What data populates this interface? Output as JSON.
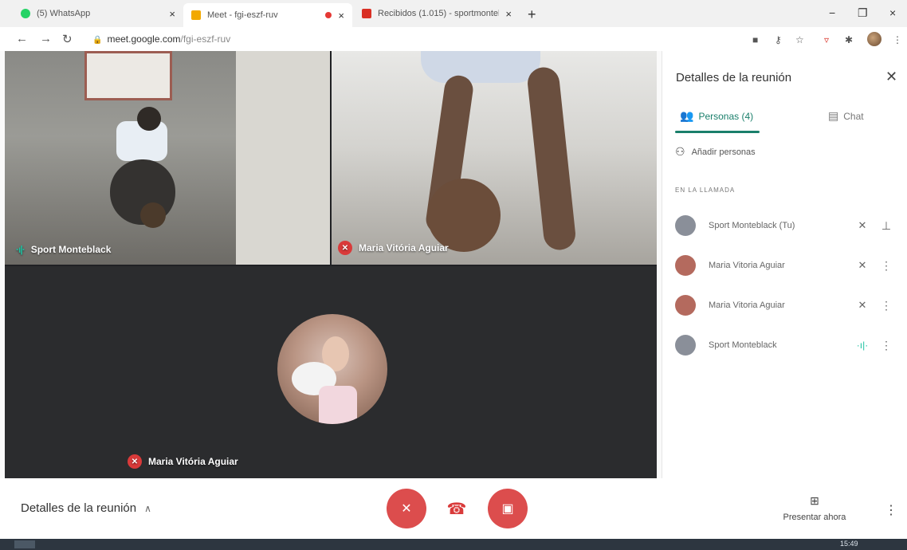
{
  "browser": {
    "tabs": [
      {
        "title": "(5) WhatsApp",
        "color": "#25D366"
      },
      {
        "title": "Meet - fgi-eszf-ruv",
        "color": "#F2A900"
      },
      {
        "title": "Recibidos (1.015) - sportmontel:",
        "color": "#D93025"
      }
    ],
    "close_glyph": "×",
    "new_tab_glyph": "+",
    "url_host": "meet.google.com",
    "url_path": "/fgi-eszf-ruv",
    "window_controls": [
      "−",
      "❐",
      "×"
    ]
  },
  "meeting": {
    "tiles": [
      {
        "name": "Sport Monteblack",
        "muted": false
      },
      {
        "name": "Maria Vitória Aguiar",
        "muted": true
      },
      {
        "name": "Maria Vitória Aguiar",
        "muted": true
      }
    ]
  },
  "panel": {
    "title": "Detalles de la reunión",
    "tab_people": "Personas (4)",
    "tab_chat": "Chat",
    "add_people": "Añadir personas",
    "section_label": "EN LA LLAMADA",
    "participants": [
      {
        "name": "Sport Monteblack (Tu)",
        "avatar": "#8a8f99",
        "mic": "muted",
        "action": "pin"
      },
      {
        "name": "Maria Vitoria Aguiar",
        "avatar": "#b46a5e",
        "mic": "muted",
        "action": "more"
      },
      {
        "name": "Maria Vitoria Aguiar",
        "avatar": "#b46a5e",
        "mic": "muted",
        "action": "more"
      },
      {
        "name": "Sport Monteblack",
        "avatar": "#8a8f99",
        "mic": "speaking",
        "action": "more"
      }
    ]
  },
  "bottombar": {
    "details": "Detalles de la reunión",
    "present": "Presentar ahora"
  },
  "taskbar": {
    "time": "15:49"
  }
}
